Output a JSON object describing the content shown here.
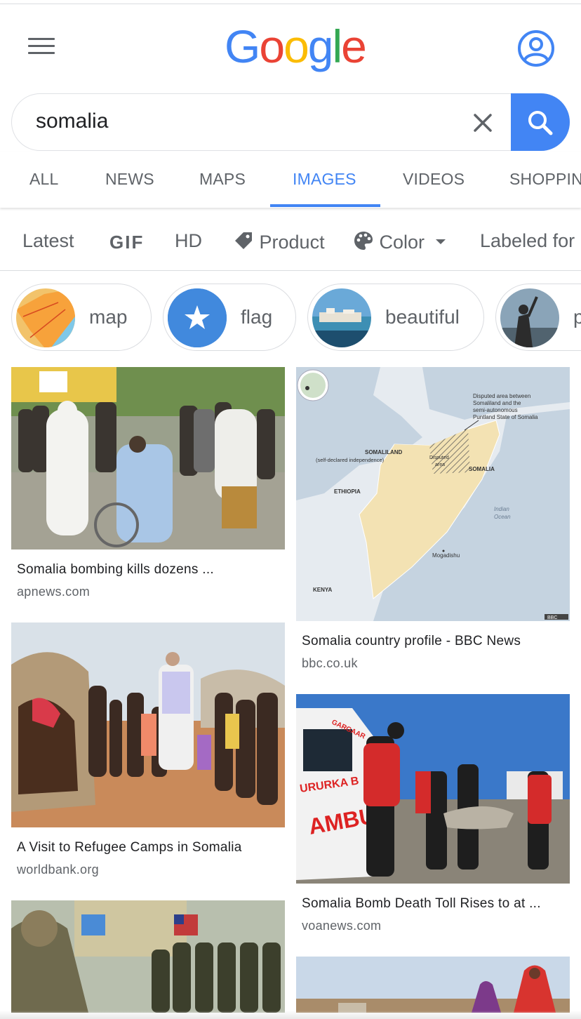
{
  "logo": {
    "letters": [
      {
        "char": "G",
        "color": "#4285f4"
      },
      {
        "char": "o",
        "color": "#ea4335"
      },
      {
        "char": "o",
        "color": "#fbbc05"
      },
      {
        "char": "g",
        "color": "#4285f4"
      },
      {
        "char": "l",
        "color": "#34a853"
      },
      {
        "char": "e",
        "color": "#ea4335"
      }
    ]
  },
  "header": {
    "menu_icon": "hamburger-menu-icon",
    "account_icon": "account-circle-icon"
  },
  "search": {
    "query": "somalia",
    "clear_icon": "close-icon",
    "search_icon": "search-icon",
    "button_color": "#4285f4"
  },
  "tabs": [
    {
      "label": "ALL",
      "active": false
    },
    {
      "label": "NEWS",
      "active": false
    },
    {
      "label": "MAPS",
      "active": false
    },
    {
      "label": "IMAGES",
      "active": true
    },
    {
      "label": "VIDEOS",
      "active": false
    },
    {
      "label": "SHOPPIN",
      "active": false
    }
  ],
  "filters": [
    {
      "label": "Latest"
    },
    {
      "label": "GIF"
    },
    {
      "label": "HD"
    },
    {
      "label": "Product",
      "icon": "tag-icon"
    },
    {
      "label": "Color",
      "icon": "palette-icon",
      "dropdown_icon": "caret-down-icon"
    },
    {
      "label": "Labeled for"
    }
  ],
  "chips": [
    {
      "label": "map"
    },
    {
      "label": "flag"
    },
    {
      "label": "beautiful"
    },
    {
      "label": "p"
    }
  ],
  "results": [
    {
      "title": "Somalia bombing kills dozens ...",
      "source": "apnews.com"
    },
    {
      "title": "Somalia country profile - BBC News",
      "source": "bbc.co.uk"
    },
    {
      "title": "A Visit to Refugee Camps in Somalia",
      "source": "worldbank.org"
    },
    {
      "title": "Somalia Bomb Death Toll Rises to at ...",
      "source": "voanews.com"
    }
  ],
  "map_labels": {
    "disputed_note": "Disputed area between Somaliland and the semi-autonomous Puntland State of Somalia",
    "somaliland": "SOMALILAND",
    "somaliland_sub": "(self-declared independence)",
    "disputed": "Disputed area",
    "somalia": "SOMALIA",
    "ethiopia": "ETHIOPIA",
    "indian_ocean": "Indian Ocean",
    "mogadishu": "Mogadishu",
    "kenya": "KENYA",
    "credit": "BBC"
  },
  "ambulance_labels": {
    "door": "URURKA B",
    "side": "AMBU",
    "roof": "GARGAAR"
  }
}
